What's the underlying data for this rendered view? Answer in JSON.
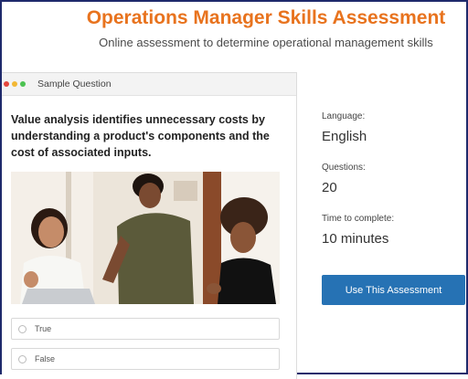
{
  "header": {
    "title": "Operations Manager Skills Assessment",
    "subtitle": "Online assessment to determine operational management skills"
  },
  "sample_card": {
    "header_label": "Sample Question",
    "question": "Value analysis identifies unnecessary costs by understanding a product's components and the cost of associated inputs.",
    "image_description_icon": "photo-three-women-at-laptop",
    "options": [
      "True",
      "False"
    ]
  },
  "details": {
    "language_label": "Language:",
    "language_value": "English",
    "questions_label": "Questions:",
    "questions_value": "20",
    "time_label": "Time to complete:",
    "time_value": "10 minutes"
  },
  "cta": {
    "label": "Use This Assessment"
  },
  "colors": {
    "title": "#e8731e",
    "button": "#2672b4",
    "frame": "#1f2a6b"
  }
}
